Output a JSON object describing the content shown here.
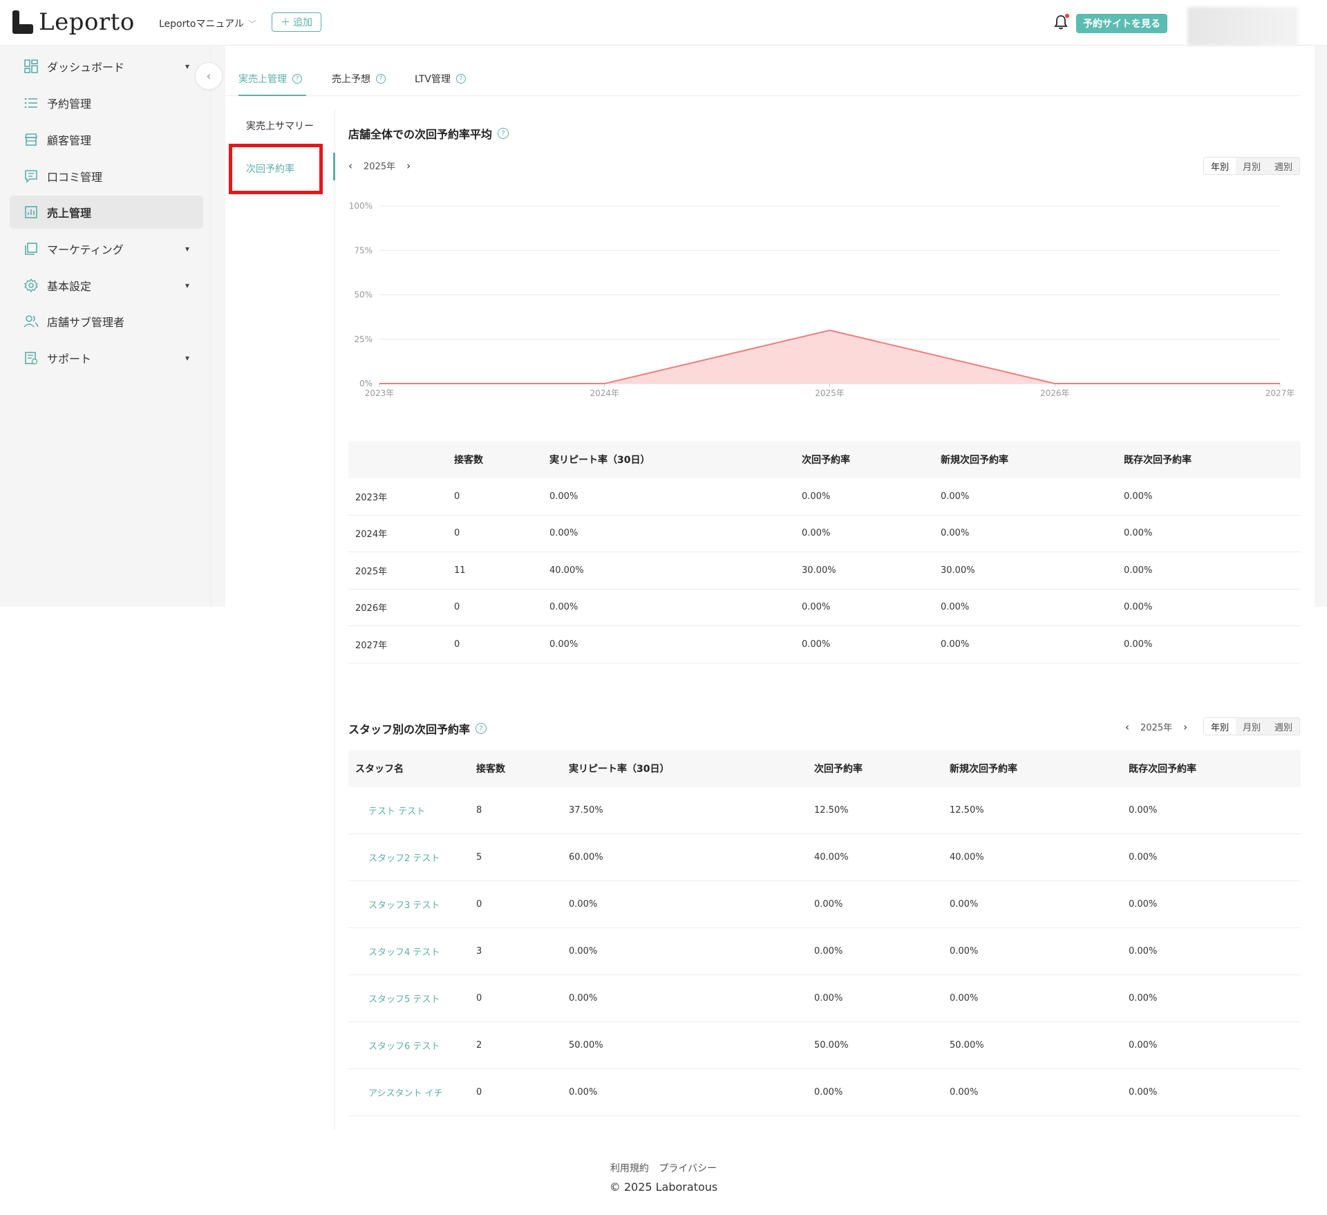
{
  "header": {
    "logo_text": "Leporto",
    "store_name": "Leportoマニュアル",
    "add_label": "追加",
    "site_button": "予約サイトを見る"
  },
  "sidebar": {
    "items": [
      {
        "label": "ダッシュボード",
        "icon": "dashboard-icon",
        "has_caret": true
      },
      {
        "label": "予約管理",
        "icon": "list-icon",
        "has_caret": false
      },
      {
        "label": "顧客管理",
        "icon": "store-icon",
        "has_caret": false
      },
      {
        "label": "口コミ管理",
        "icon": "comment-icon",
        "has_caret": false
      },
      {
        "label": "売上管理",
        "icon": "chart-icon",
        "has_caret": false,
        "active": true
      },
      {
        "label": "マーケティング",
        "icon": "copy-icon",
        "has_caret": true
      },
      {
        "label": "基本設定",
        "icon": "gear-icon",
        "has_caret": true
      },
      {
        "label": "店舗サブ管理者",
        "icon": "users-icon",
        "has_caret": false
      },
      {
        "label": "サポート",
        "icon": "support-icon",
        "has_caret": true
      }
    ]
  },
  "tabs": [
    {
      "label": "実売上管理",
      "active": true
    },
    {
      "label": "売上予想",
      "active": false
    },
    {
      "label": "LTV管理",
      "active": false
    }
  ],
  "submenu": [
    {
      "label": "実売上サマリー",
      "active": false
    },
    {
      "label": "次回予約率",
      "active": true
    }
  ],
  "avg_section": {
    "title": "店舗全体での次回予約率平均",
    "year": "2025年",
    "periods": [
      "年別",
      "月別",
      "週別"
    ],
    "active_period": "年別"
  },
  "chart_data": {
    "type": "area",
    "x": [
      "2023年",
      "2024年",
      "2025年",
      "2026年",
      "2027年"
    ],
    "series": [
      {
        "values": [
          0,
          0,
          30,
          0,
          0
        ]
      }
    ],
    "yticks": [
      "0%",
      "25%",
      "50%",
      "75%",
      "100%"
    ],
    "ylim": [
      0,
      100
    ],
    "grid": true,
    "color": "#f47b7b"
  },
  "avg_table": {
    "headers": [
      "",
      "接客数",
      "実リピート率（30日）",
      "次回予約率",
      "新規次回予約率",
      "既存次回予約率"
    ],
    "rows": [
      [
        "2023年",
        "0",
        "0.00%",
        "0.00%",
        "0.00%",
        "0.00%"
      ],
      [
        "2024年",
        "0",
        "0.00%",
        "0.00%",
        "0.00%",
        "0.00%"
      ],
      [
        "2025年",
        "11",
        "40.00%",
        "30.00%",
        "30.00%",
        "0.00%"
      ],
      [
        "2026年",
        "0",
        "0.00%",
        "0.00%",
        "0.00%",
        "0.00%"
      ],
      [
        "2027年",
        "0",
        "0.00%",
        "0.00%",
        "0.00%",
        "0.00%"
      ]
    ]
  },
  "staff_section": {
    "title": "スタッフ別の次回予約率",
    "year": "2025年",
    "periods": [
      "年別",
      "月別",
      "週別"
    ],
    "active_period": "年別"
  },
  "staff_table": {
    "headers": [
      "スタッフ名",
      "接客数",
      "実リピート率（30日）",
      "次回予約率",
      "新規次回予約率",
      "既存次回予約率"
    ],
    "rows": [
      [
        "テスト テスト",
        "8",
        "37.50%",
        "12.50%",
        "12.50%",
        "0.00%"
      ],
      [
        "スタッフ2 テスト",
        "5",
        "60.00%",
        "40.00%",
        "40.00%",
        "0.00%"
      ],
      [
        "スタッフ3 テスト",
        "0",
        "0.00%",
        "0.00%",
        "0.00%",
        "0.00%"
      ],
      [
        "スタッフ4 テスト",
        "3",
        "0.00%",
        "0.00%",
        "0.00%",
        "0.00%"
      ],
      [
        "スタッフ5 テスト",
        "0",
        "0.00%",
        "0.00%",
        "0.00%",
        "0.00%"
      ],
      [
        "スタッフ6 テスト",
        "2",
        "50.00%",
        "50.00%",
        "50.00%",
        "0.00%"
      ],
      [
        "アシスタント イチ",
        "0",
        "0.00%",
        "0.00%",
        "0.00%",
        "0.00%"
      ]
    ]
  },
  "footer": {
    "terms": "利用規約",
    "privacy": "プライバシー",
    "copyright": "© 2025 Laboratous"
  },
  "colors": {
    "accent": "#5aaea8",
    "site_button": "#5bbcb2",
    "highlight": "#e8151b",
    "chart_line": "#f47b7b",
    "chart_fill": "#fdd6d6"
  }
}
